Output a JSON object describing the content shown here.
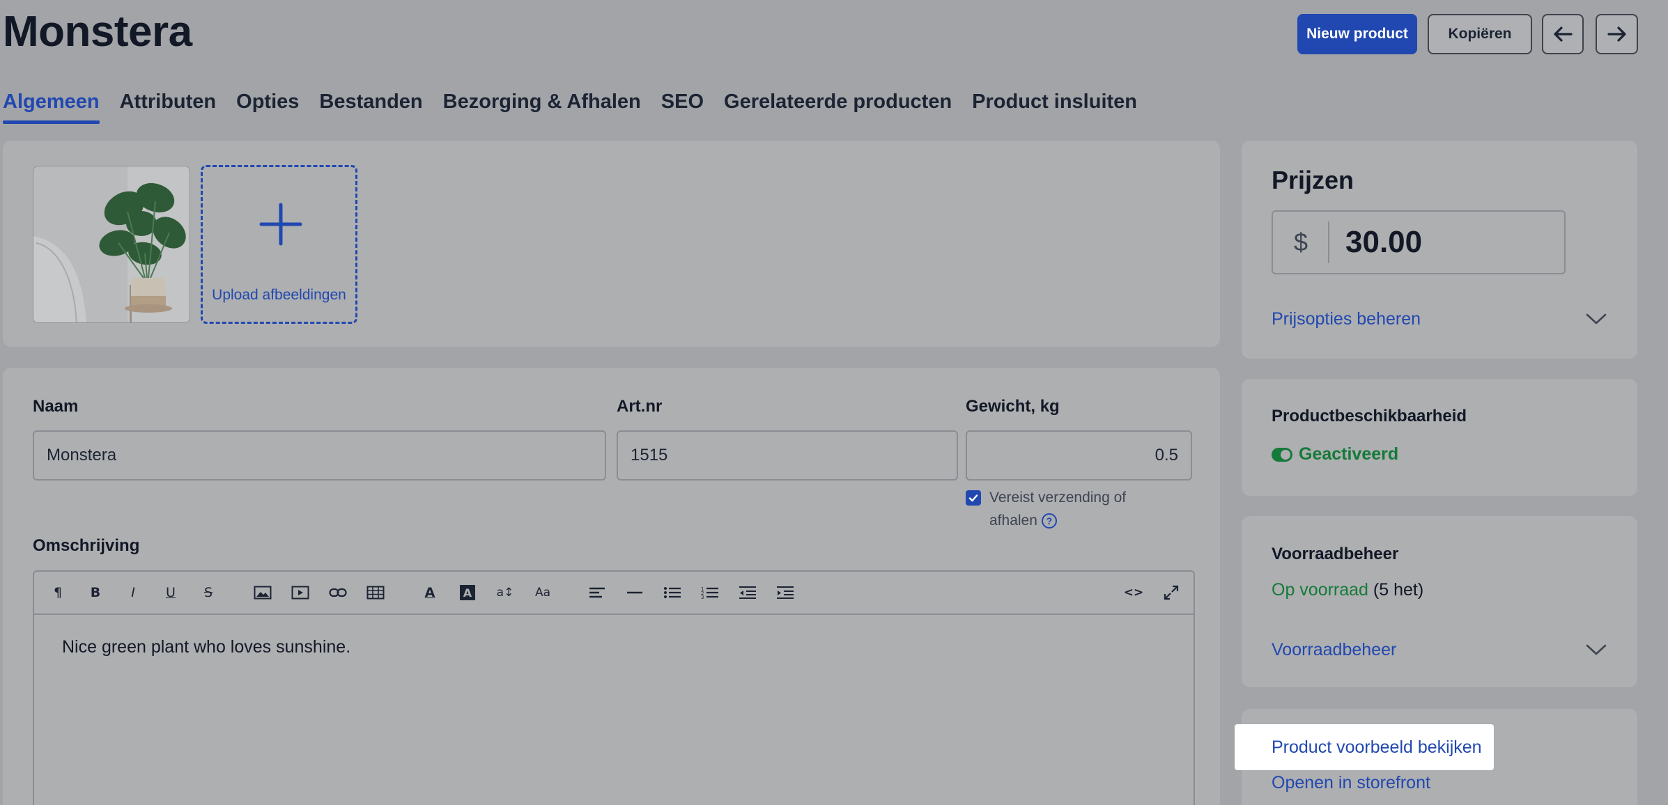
{
  "header": {
    "title": "Monstera",
    "new_product": "Nieuw product",
    "copy": "Kopiëren"
  },
  "tabs": [
    {
      "label": "Algemeen",
      "active": true
    },
    {
      "label": "Attributen"
    },
    {
      "label": "Opties"
    },
    {
      "label": "Bestanden"
    },
    {
      "label": "Bezorging & Afhalen"
    },
    {
      "label": "SEO"
    },
    {
      "label": "Gerelateerde producten"
    },
    {
      "label": "Product insluiten"
    }
  ],
  "images": {
    "upload_label": "Upload afbeeldingen"
  },
  "form": {
    "name_label": "Naam",
    "name_value": "Monstera",
    "sku_label": "Art.nr",
    "sku_value": "1515",
    "weight_label": "Gewicht, kg",
    "weight_value": "0.5",
    "shipping_required": true,
    "shipping_text": "Vereist verzending of afhalen",
    "description_label": "Omschrijving",
    "description_text": "Nice green plant who loves sunshine."
  },
  "prices": {
    "title": "Prijzen",
    "currency": "$",
    "price": "30.00",
    "manage_link": "Prijsopties beheren"
  },
  "availability": {
    "title": "Productbeschikbaarheid",
    "status": "Geactiveerd"
  },
  "stock": {
    "title": "Voorraadbeheer",
    "status": "Op voorraad",
    "count": "(5 het)",
    "manage_link": "Voorraadbeheer"
  },
  "links": {
    "preview": "Product voorbeeld bekijken",
    "storefront": "Openen in storefront"
  },
  "colors": {
    "accent": "#2148b0",
    "success": "#157a3a",
    "overlay_bg": "#a2a4a8"
  }
}
